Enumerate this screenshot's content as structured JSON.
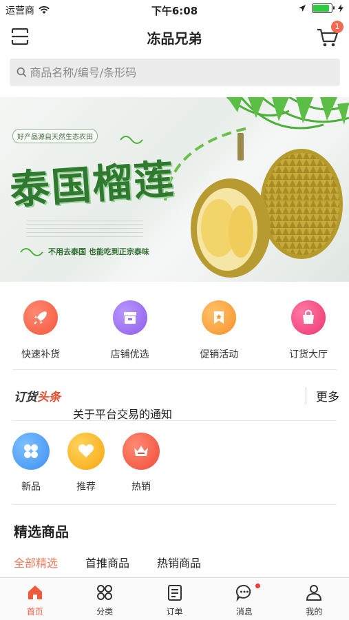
{
  "status_bar": {
    "carrier": "运营商",
    "time": "下午6:08",
    "battery_level": 0.9
  },
  "header": {
    "title": "冻品兄弟",
    "cart_count": "1"
  },
  "search": {
    "placeholder": "商品名称/编号/条形码"
  },
  "banner": {
    "headline": "泰国榴莲",
    "tagline_top": "好产品源自天然生态农田",
    "tagline_bottom": "不用去泰国   也能吃到正宗泰味"
  },
  "quick_actions": [
    {
      "label": "快速补货",
      "icon": "rocket-icon",
      "color": "#f4553e"
    },
    {
      "label": "店铺优选",
      "icon": "store-icon",
      "color": "#9a6cf0"
    },
    {
      "label": "促销活动",
      "icon": "ribbon-icon",
      "color": "#f79a2e"
    },
    {
      "label": "订货大厅",
      "icon": "shopping-bag-icon",
      "color": "#f2427a"
    }
  ],
  "news": {
    "logo_part1": "订货",
    "logo_part2": "头条",
    "item": "关于平台交易的通知",
    "more": "更多"
  },
  "categories": [
    {
      "label": "新品",
      "icon": "grid-icon",
      "color": "#3d8ff2"
    },
    {
      "label": "推荐",
      "icon": "heart-icon",
      "color": "#f7b21e"
    },
    {
      "label": "热销",
      "icon": "crown-icon",
      "color": "#f25c48"
    }
  ],
  "featured": {
    "title": "精选商品",
    "tabs": [
      "全部精选",
      "首推商品",
      "热销商品"
    ],
    "active_tab": 0
  },
  "tabbar": [
    {
      "label": "首页",
      "icon": "home-icon",
      "active": true
    },
    {
      "label": "分类",
      "icon": "category-icon",
      "active": false
    },
    {
      "label": "订单",
      "icon": "order-icon",
      "active": false
    },
    {
      "label": "消息",
      "icon": "message-icon",
      "active": false,
      "unread": true
    },
    {
      "label": "我的",
      "icon": "profile-icon",
      "active": false
    }
  ],
  "colors": {
    "accent": "#f05a3a",
    "banner_green": "#2f7a2f"
  }
}
